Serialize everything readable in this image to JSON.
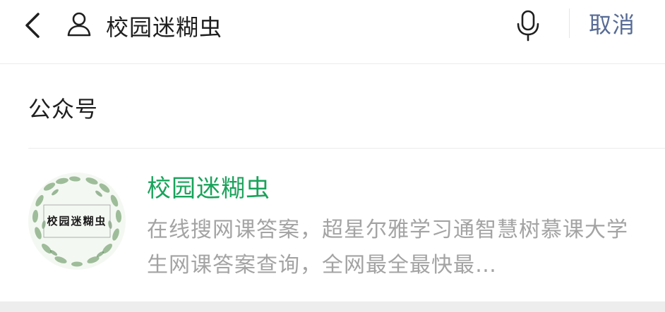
{
  "search": {
    "query": "校园迷糊虫",
    "cancel_label": "取消"
  },
  "icons": {
    "back": "chevron-left-icon",
    "type": "person-icon",
    "voice": "microphone-icon"
  },
  "section": {
    "title": "公众号"
  },
  "result": {
    "name": "校园迷糊虫",
    "description": "在线搜网课答案，超星尔雅学习通智慧树慕课大学生网课答案查询，全网最全最快最…",
    "avatar_text": "校园迷糊虫"
  },
  "colors": {
    "accent_green": "#19a35b",
    "link_blue": "#576b95",
    "muted_text": "#a3a3a3",
    "bottom_band": "#ededed"
  }
}
